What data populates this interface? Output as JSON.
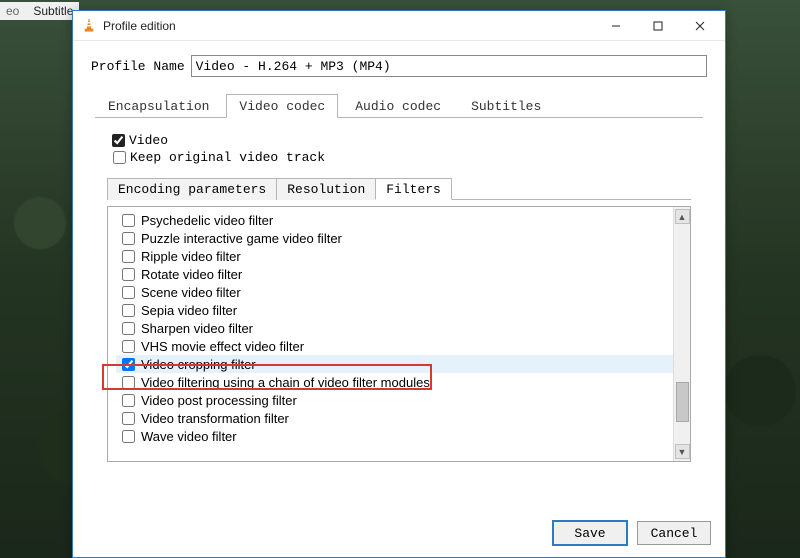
{
  "bg_menu": {
    "item1": "eo",
    "item2": "Subtitle"
  },
  "window": {
    "title": "Profile edition"
  },
  "profile": {
    "label": "Profile Name",
    "value": "Video - H.264 + MP3 (MP4)"
  },
  "main_tabs": [
    {
      "id": "encapsulation",
      "label": "Encapsulation",
      "active": false
    },
    {
      "id": "video-codec",
      "label": "Video codec",
      "active": true
    },
    {
      "id": "audio-codec",
      "label": "Audio codec",
      "active": false
    },
    {
      "id": "subtitles",
      "label": "Subtitles",
      "active": false
    }
  ],
  "video_group": {
    "video_label": "Video",
    "video_checked": true,
    "keep_label": "Keep original video track",
    "keep_checked": false
  },
  "sub_tabs": [
    {
      "id": "encoding",
      "label": "Encoding parameters",
      "active": false
    },
    {
      "id": "resolution",
      "label": "Resolution",
      "active": false
    },
    {
      "id": "filters",
      "label": "Filters",
      "active": true
    }
  ],
  "filters": [
    {
      "label": "Psychedelic video filter",
      "checked": false,
      "selected": false
    },
    {
      "label": "Puzzle interactive game video filter",
      "checked": false,
      "selected": false
    },
    {
      "label": "Ripple video filter",
      "checked": false,
      "selected": false
    },
    {
      "label": "Rotate video filter",
      "checked": false,
      "selected": false
    },
    {
      "label": "Scene video filter",
      "checked": false,
      "selected": false
    },
    {
      "label": "Sepia video filter",
      "checked": false,
      "selected": false
    },
    {
      "label": "Sharpen video filter",
      "checked": false,
      "selected": false
    },
    {
      "label": "VHS movie effect video filter",
      "checked": false,
      "selected": false
    },
    {
      "label": "Video cropping filter",
      "checked": true,
      "selected": true
    },
    {
      "label": "Video filtering using a chain of video filter modules",
      "checked": false,
      "selected": false
    },
    {
      "label": "Video post processing filter",
      "checked": false,
      "selected": false
    },
    {
      "label": "Video transformation filter",
      "checked": false,
      "selected": false
    },
    {
      "label": "Wave video filter",
      "checked": false,
      "selected": false
    }
  ],
  "buttons": {
    "save": "Save",
    "cancel": "Cancel"
  }
}
